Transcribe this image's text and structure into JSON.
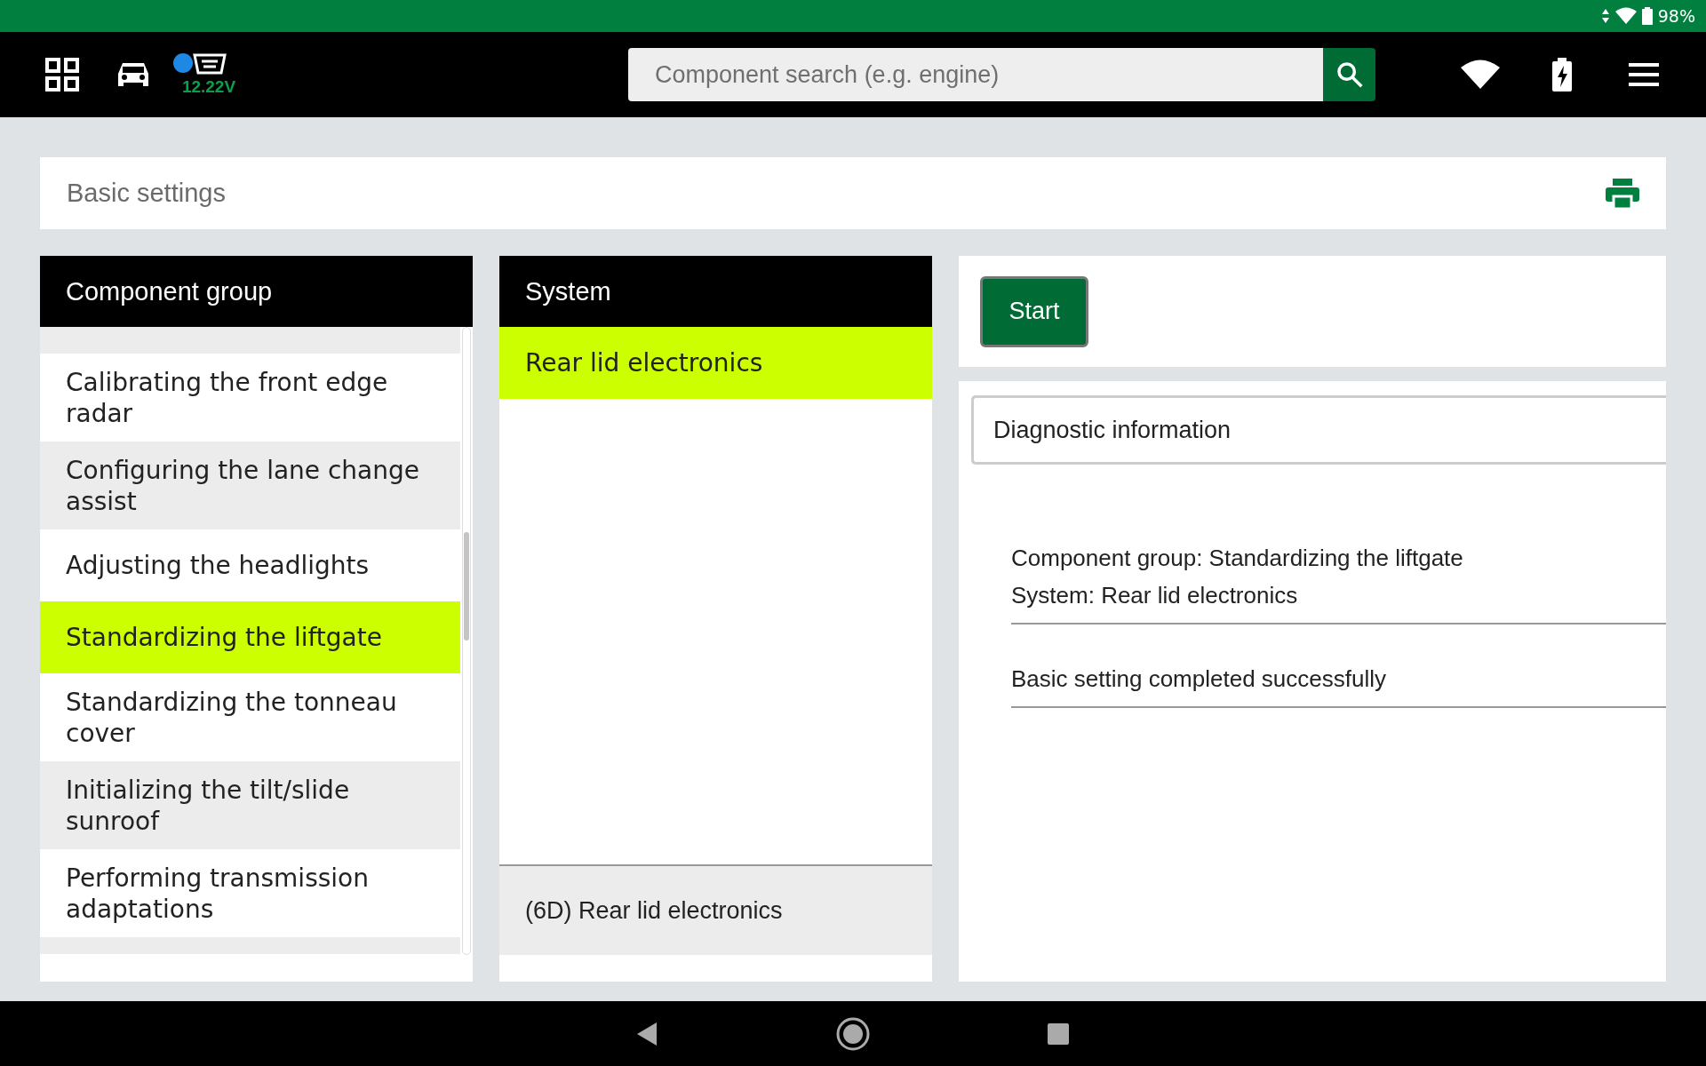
{
  "status_bar": {
    "battery": "98%"
  },
  "top_bar": {
    "voltage": "12.22V",
    "search": {
      "placeholder": "Component search (e.g. engine)"
    }
  },
  "page_title": "Basic settings",
  "component_group": {
    "title": "Component group",
    "items": [
      {
        "label": "Calibrating the front edge radar",
        "selected": false
      },
      {
        "label": "Configuring the lane change assist",
        "selected": false
      },
      {
        "label": "Adjusting the headlights",
        "selected": false
      },
      {
        "label": "Standardizing the liftgate",
        "selected": true
      },
      {
        "label": "Standardizing the tonneau cover",
        "selected": false
      },
      {
        "label": "Initializing the tilt/slide sunroof",
        "selected": false
      },
      {
        "label": "Performing transmission adaptations",
        "selected": false
      }
    ]
  },
  "system": {
    "title": "System",
    "items": [
      {
        "label": "Rear lid electronics",
        "selected": true
      }
    ],
    "footer": "(6D) Rear lid electronics"
  },
  "actions": {
    "start": "Start"
  },
  "diagnostic": {
    "title": "Diagnostic information",
    "lines": [
      "Component group: Standardizing the liftgate",
      "System: Rear lid electronics"
    ],
    "result": "Basic setting completed successfully"
  }
}
